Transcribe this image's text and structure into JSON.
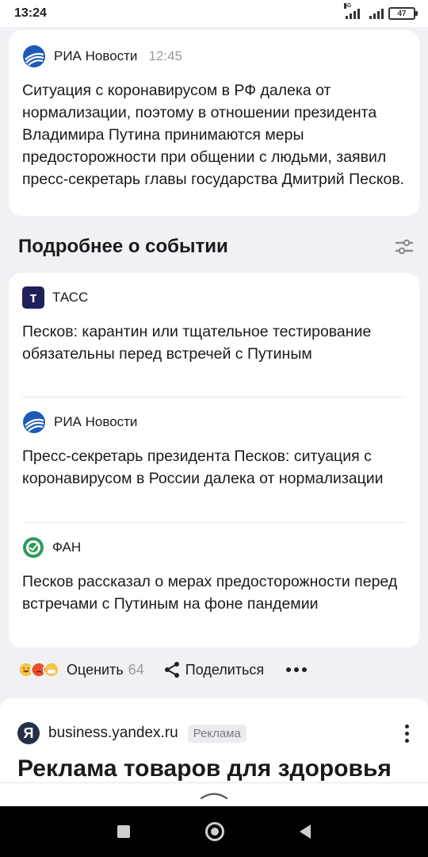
{
  "status_bar": {
    "time": "13:24",
    "network": "4G",
    "battery": "47"
  },
  "lead_card": {
    "source": "РИА Новости",
    "time": "12:45",
    "text": "Ситуация с коронавирусом в РФ далека от нормализации, поэтому в отношении президента Владимира Путина принимаются меры предосторожности при общении с людьми, заявил пресс-секретарь главы государства Дмитрий Песков."
  },
  "section": {
    "title": "Подробнее о событии"
  },
  "stories": [
    {
      "source": "ТАСС",
      "logo_letter": "т",
      "title": "Песков: карантин или тщательное тестирование обязательны перед встречей с Путиным"
    },
    {
      "source": "РИА Новости",
      "title": "Пресс-секретарь президента Песков: ситуация с коронавирусом в России далека от нормализации"
    },
    {
      "source": "ФАН",
      "title": "Песков рассказал о мерах предосторожности перед встречами с Путиным на фоне пандемии"
    }
  ],
  "actions": {
    "rate_label": "Оценить",
    "rate_count": "64",
    "share_label": "Поделиться"
  },
  "ad": {
    "logo_letter": "Я",
    "domain": "business.yandex.ru",
    "badge": "Реклама",
    "headline": "Реклама товаров для здоровья"
  },
  "colors": {
    "background": "#f1f1f5",
    "card": "#ffffff",
    "ria_blue": "#1e5bb8",
    "tass_navy": "#20205a",
    "fan_green": "#2e9a5a",
    "muted_text": "#9a9a9a"
  }
}
